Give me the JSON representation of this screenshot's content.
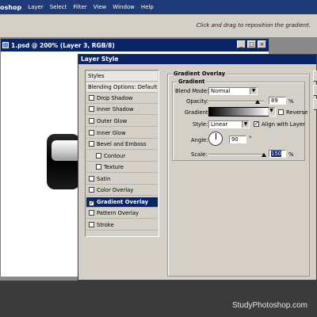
{
  "menubar": {
    "app_title": "oshop",
    "items": [
      "p",
      "Layer",
      "Select",
      "Filter",
      "View",
      "Window",
      "Help"
    ]
  },
  "options_bar": {
    "hint": "Click and drag to reposition the gradient."
  },
  "document_window": {
    "title": "1.psd @ 200% (Layer 3, RGB/8)",
    "minimize": "_",
    "maximize": "□",
    "close": "×"
  },
  "dialog": {
    "title": "Layer Style",
    "styles_list": [
      {
        "label": "Styles",
        "type": "header"
      },
      {
        "label": "Blending Options: Default",
        "type": "header"
      },
      {
        "label": "Drop Shadow",
        "type": "check",
        "checked": false
      },
      {
        "label": "Inner Shadow",
        "type": "check",
        "checked": false
      },
      {
        "label": "Outer Glow",
        "type": "check",
        "checked": false
      },
      {
        "label": "Inner Glow",
        "type": "check",
        "checked": false
      },
      {
        "label": "Bevel and Emboss",
        "type": "check",
        "checked": false
      },
      {
        "label": "Contour",
        "type": "sub",
        "checked": false
      },
      {
        "label": "Texture",
        "type": "sub",
        "checked": false
      },
      {
        "label": "Satin",
        "type": "check",
        "checked": false
      },
      {
        "label": "Color Overlay",
        "type": "check",
        "checked": false
      },
      {
        "label": "Gradient Overlay",
        "type": "check",
        "checked": true,
        "selected": true
      },
      {
        "label": "Pattern Overlay",
        "type": "check",
        "checked": false
      },
      {
        "label": "Stroke",
        "type": "check",
        "checked": false
      }
    ],
    "panel": {
      "section_title": "Gradient Overlay",
      "group_title": "Gradient",
      "blend_mode_label": "Blend Mode:",
      "blend_mode_value": "Normal",
      "opacity_label": "Opacity:",
      "opacity_value": "89",
      "opacity_unit": "%",
      "opacity_fraction": 0.89,
      "gradient_label": "Gradient:",
      "reverse_label": "Reverse",
      "reverse_checked": false,
      "style_label": "Style:",
      "style_value": "Linear",
      "align_label": "Align with Layer",
      "align_checked": true,
      "angle_label": "Angle:",
      "angle_value": "90",
      "angle_unit": "°",
      "scale_label": "Scale:",
      "scale_value": "150",
      "scale_unit": "%",
      "scale_fraction": 1.0
    }
  },
  "watermark": "StudyPhotoshop.com",
  "colors": {
    "titlebar": "#0a246a",
    "dialog_bg": "#d4d0c8",
    "selected_row": "#0a246a"
  }
}
